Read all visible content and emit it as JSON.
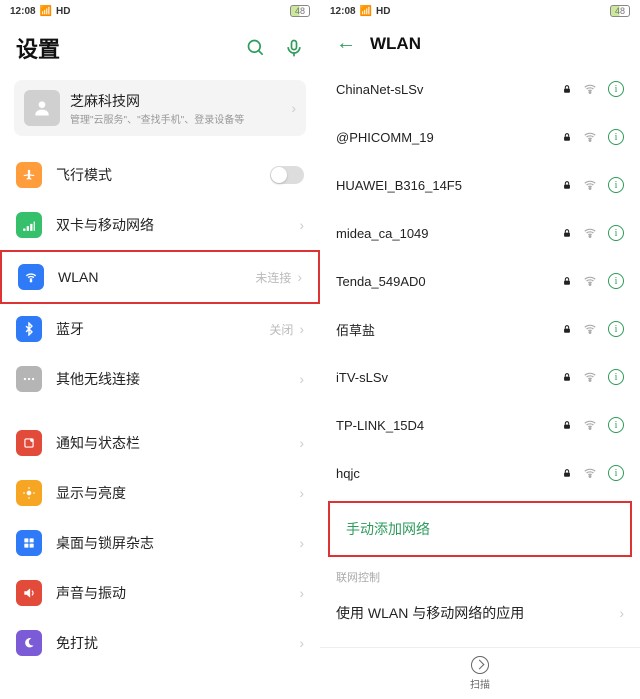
{
  "statusbar": {
    "time": "12:08",
    "signal": "HD",
    "battery": "48"
  },
  "left": {
    "title": "设置",
    "profile": {
      "name": "芝麻科技网",
      "sub": "管理\"云服务\"、\"查找手机\"、登录设备等"
    },
    "rows": [
      {
        "label": "飞行模式",
        "status": "",
        "color": "#ff9c3c",
        "icon": "airplane"
      },
      {
        "label": "双卡与移动网络",
        "status": "",
        "color": "#36c06b",
        "icon": "sim"
      },
      {
        "label": "WLAN",
        "status": "未连接",
        "color": "#2f7af6",
        "icon": "wifi",
        "highlight": true
      },
      {
        "label": "蓝牙",
        "status": "关闭",
        "color": "#2f7af6",
        "icon": "bt"
      },
      {
        "label": "其他无线连接",
        "status": "",
        "color": "#b5b5b5",
        "icon": "dots"
      },
      {
        "label": "通知与状态栏",
        "status": "",
        "color": "#e24a3a",
        "icon": "notif"
      },
      {
        "label": "显示与亮度",
        "status": "",
        "color": "#f6a623",
        "icon": "bright"
      },
      {
        "label": "桌面与锁屏杂志",
        "status": "",
        "color": "#2f7af6",
        "icon": "home"
      },
      {
        "label": "声音与振动",
        "status": "",
        "color": "#e24a3a",
        "icon": "sound"
      },
      {
        "label": "免打扰",
        "status": "",
        "color": "#7c5cd6",
        "icon": "dnd"
      }
    ]
  },
  "right": {
    "title": "WLAN",
    "networks": [
      {
        "name": "ChinaNet-sLSv",
        "locked": true
      },
      {
        "name": "@PHICOMM_19",
        "locked": true
      },
      {
        "name": "HUAWEI_B316_14F5",
        "locked": true
      },
      {
        "name": "midea_ca_1049",
        "locked": true
      },
      {
        "name": "Tenda_549AD0",
        "locked": true
      },
      {
        "name": "佰草盐",
        "locked": true
      },
      {
        "name": "iTV-sLSv",
        "locked": true
      },
      {
        "name": "TP-LINK_15D4",
        "locked": true
      },
      {
        "name": "hqjc",
        "locked": true
      }
    ],
    "add_network": "手动添加网络",
    "section_label": "联网控制",
    "apps_row": "使用 WLAN 与移动网络的应用",
    "scan_label": "扫描"
  }
}
